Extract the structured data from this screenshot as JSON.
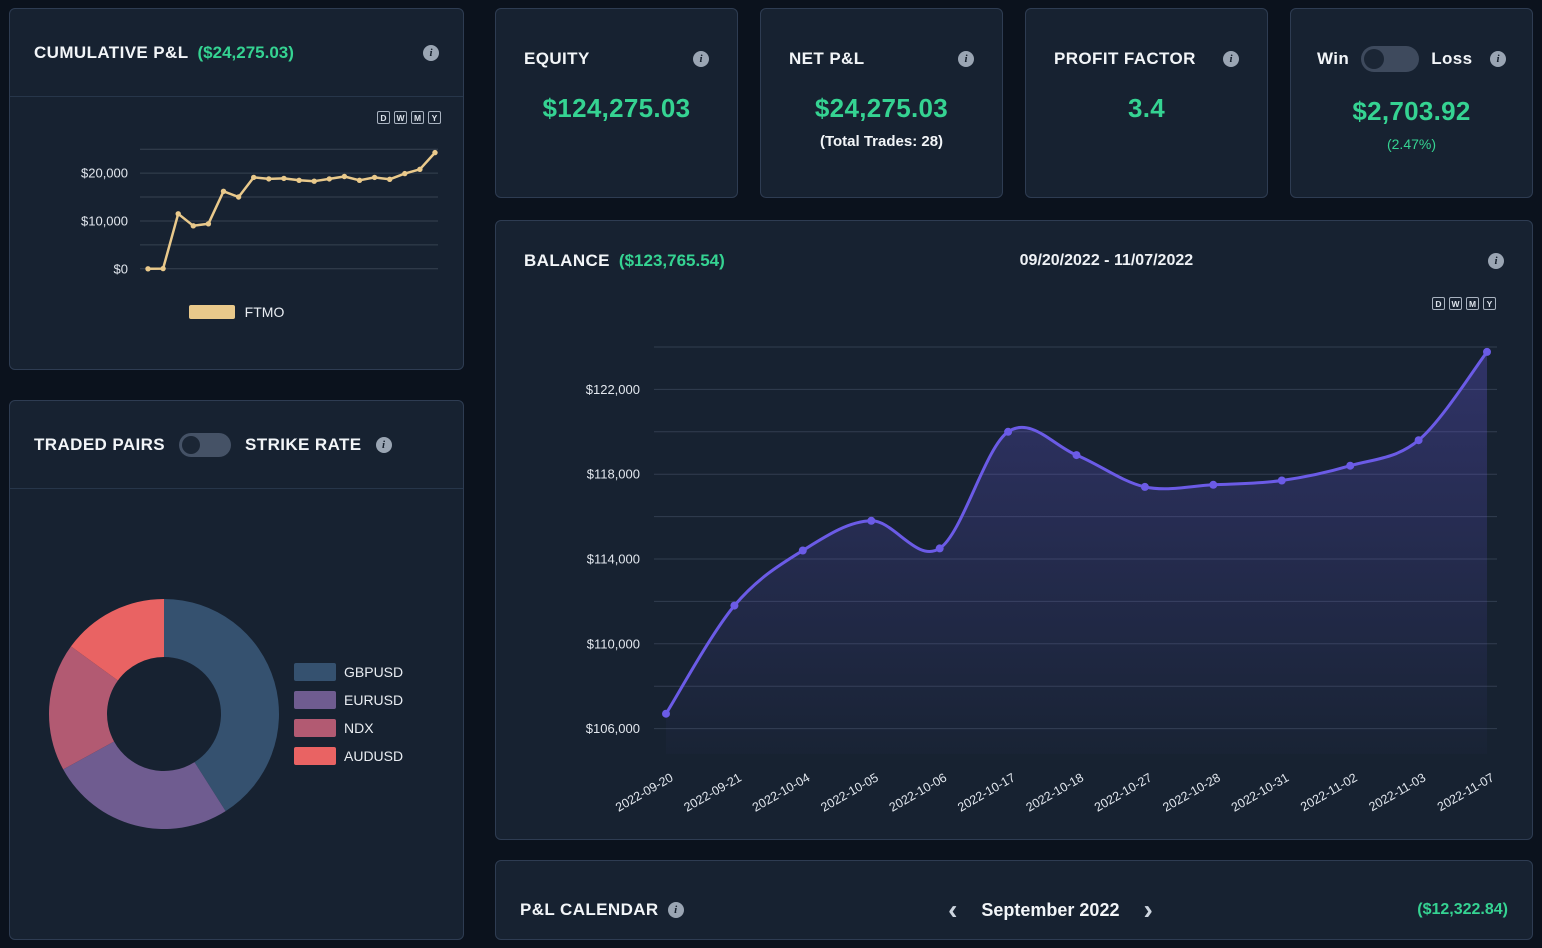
{
  "icons": {
    "info": "i",
    "prev": "‹",
    "next": "›"
  },
  "colors": {
    "green": "#35d392",
    "cumulative_line": "#e9c98b",
    "balance_line": "#6b5be6",
    "donut": [
      "#35516f",
      "#6f5c90",
      "#b25a72",
      "#e96363"
    ]
  },
  "cumulative_card": {
    "title": "CUMULATIVE P&L",
    "value": "($24,275.03)",
    "legend_label": "FTMO",
    "range_buttons": [
      "D",
      "W",
      "M",
      "Y"
    ]
  },
  "stat_cards": {
    "equity": {
      "label": "EQUITY",
      "value": "$124,275.03"
    },
    "net_pnl": {
      "label": "NET P&L",
      "value": "$24,275.03",
      "subtext": "(Total Trades: 28)"
    },
    "profit_factor": {
      "label": "PROFIT FACTOR",
      "value": "3.4"
    },
    "win_loss": {
      "win_label": "Win",
      "loss_label": "Loss",
      "value": "$2,703.92",
      "subtext": "(2.47%)"
    }
  },
  "traded_pairs_card": {
    "left_label": "TRADED PAIRS",
    "right_label": "STRIKE RATE"
  },
  "balance_card": {
    "title": "BALANCE",
    "value": "($123,765.54)",
    "date_range": "09/20/2022 - 11/07/2022",
    "range_buttons": [
      "D",
      "W",
      "M",
      "Y"
    ]
  },
  "calendar_card": {
    "title": "P&L CALENDAR",
    "month_label": "September 2022",
    "value": "($12,322.84)"
  },
  "chart_data": [
    {
      "id": "cumulative_pnl",
      "type": "line",
      "title": "CUMULATIVE P&L",
      "series": [
        {
          "name": "FTMO",
          "values": [
            0,
            50,
            11500,
            9000,
            9400,
            16200,
            15000,
            19100,
            18800,
            18900,
            18500,
            18300,
            18800,
            19300,
            18500,
            19100,
            18700,
            19900,
            20800,
            24275
          ]
        }
      ],
      "ylim": [
        -1500,
        26500
      ],
      "gridlines": [
        0,
        5000,
        10000,
        15000,
        20000,
        25000
      ],
      "ytick_values": [
        0,
        10000,
        20000
      ],
      "ytick_labels": [
        "$0",
        "$10,000",
        "$20,000"
      ],
      "line_color": "#e9c98b",
      "legend_position": "bottom"
    },
    {
      "id": "balance",
      "type": "line",
      "title": "BALANCE",
      "x": [
        "2022-09-20",
        "2022-09-21",
        "2022-10-04",
        "2022-10-05",
        "2022-10-06",
        "2022-10-17",
        "2022-10-18",
        "2022-10-27",
        "2022-10-28",
        "2022-10-31",
        "2022-11-02",
        "2022-11-03",
        "2022-11-07"
      ],
      "values": [
        106700,
        111800,
        114400,
        115800,
        114500,
        120000,
        118900,
        117400,
        117500,
        117700,
        118400,
        119600,
        123765
      ],
      "ylim": [
        104800,
        124800
      ],
      "gridlines": [
        106000,
        108000,
        110000,
        112000,
        114000,
        116000,
        118000,
        120000,
        122000,
        124000
      ],
      "ytick_values": [
        106000,
        110000,
        114000,
        118000,
        122000
      ],
      "ytick_labels": [
        "$106,000",
        "$110,000",
        "$114,000",
        "$118,000",
        "$122,000"
      ],
      "line_color": "#6b5be6",
      "smooth": true,
      "area": true
    },
    {
      "id": "traded_pairs",
      "type": "pie",
      "donut": true,
      "labels": [
        "GBPUSD",
        "EURUSD",
        "NDX",
        "AUDUSD"
      ],
      "values": [
        41,
        26,
        18,
        15
      ],
      "colors": [
        "#35516f",
        "#6f5c90",
        "#b25a72",
        "#e96363"
      ]
    }
  ]
}
